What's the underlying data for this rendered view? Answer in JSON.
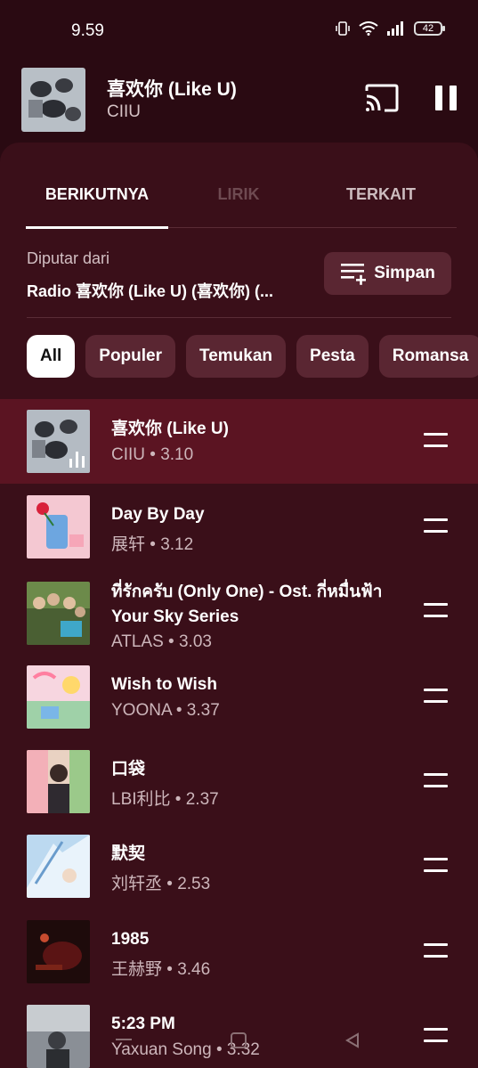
{
  "status_bar": {
    "time": "9.59",
    "battery": "42"
  },
  "now_playing": {
    "title": "喜欢你 (Like U)",
    "artist": "CIIU"
  },
  "tabs": [
    {
      "label": "BERIKUTNYA"
    },
    {
      "label": "LIRIK"
    },
    {
      "label": "TERKAIT"
    }
  ],
  "playing_from": {
    "label": "Diputar dari",
    "source": "Radio 喜欢你 (Like U) (喜欢你) (..."
  },
  "save_button": {
    "label": "Simpan"
  },
  "chips": [
    {
      "label": "All"
    },
    {
      "label": "Populer"
    },
    {
      "label": "Temukan"
    },
    {
      "label": "Pesta"
    },
    {
      "label": "Romansa"
    }
  ],
  "queue": [
    {
      "title": "喜欢你 (Like U)",
      "subtitle": "CIIU • 3.10"
    },
    {
      "title": "Day By Day",
      "subtitle": "展轩 • 3.12"
    },
    {
      "title": "ที่รักครับ (Only One) - Ost. กี่หมื่นฟ้า Your Sky Series",
      "subtitle": "ATLAS • 3.03"
    },
    {
      "title": "Wish to Wish",
      "subtitle": "YOONA • 3.37"
    },
    {
      "title": "口袋",
      "subtitle": "LBI利比 • 2.37"
    },
    {
      "title": "默契",
      "subtitle": "刘轩丞 • 2.53"
    },
    {
      "title": "1985",
      "subtitle": "王赫野 • 3.46"
    },
    {
      "title": "5:23 PM",
      "subtitle": "Yaxuan Song • 3.32"
    }
  ],
  "colors": {
    "background": "#2a0a12",
    "sheet": "#3a0f19",
    "current_row": "#5b1422",
    "chip": "#5a2632"
  },
  "icons": [
    "vibrate-icon",
    "wifi-icon",
    "signal-icon",
    "battery-icon",
    "cast-icon",
    "pause-icon",
    "playlist-add-icon",
    "equalizer-icon",
    "drag-handle-icon",
    "nav-menu-icon",
    "nav-home-icon",
    "nav-back-icon"
  ]
}
